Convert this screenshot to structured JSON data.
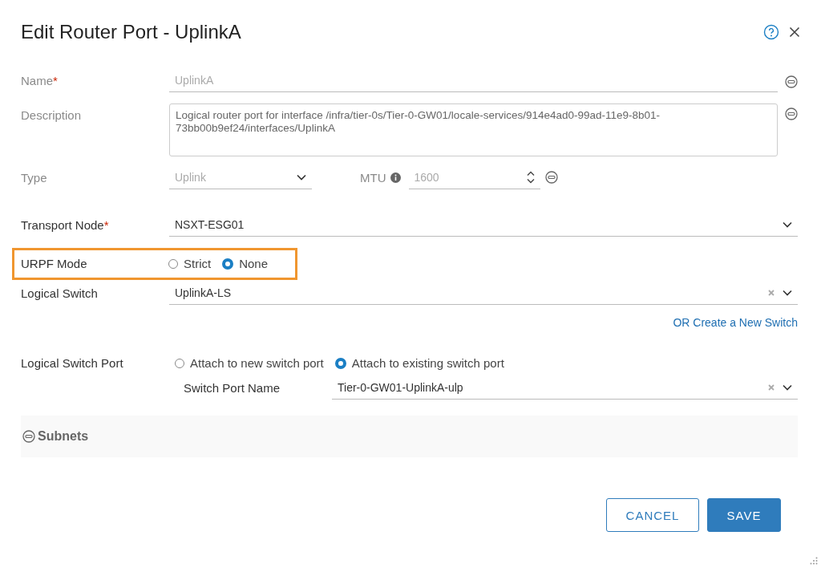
{
  "dialog": {
    "title": "Edit Router Port - UplinkA"
  },
  "name": {
    "label": "Name",
    "required_mark": "*",
    "value": "UplinkA",
    "disabled": true
  },
  "description": {
    "label": "Description",
    "value": "Logical router port for interface /infra/tier-0s/Tier-0-GW01/locale-services/914e4ad0-99ad-11e9-8b01-73bb00b9ef24/interfaces/UplinkA",
    "disabled": true
  },
  "type": {
    "label": "Type",
    "value": "Uplink",
    "disabled": true
  },
  "mtu": {
    "label": "MTU",
    "value": "1600",
    "disabled": true
  },
  "transport_node": {
    "label": "Transport Node",
    "required_mark": "*",
    "value": "NSXT-ESG01",
    "disabled": false
  },
  "urpf_mode": {
    "label": "URPF Mode",
    "highlighted": true,
    "options": [
      {
        "label": "Strict",
        "selected": false
      },
      {
        "label": "None",
        "selected": true
      }
    ]
  },
  "logical_switch": {
    "label": "Logical Switch",
    "value": "UplinkA-LS",
    "link": "OR Create a New Switch"
  },
  "logical_switch_port": {
    "label": "Logical Switch Port",
    "options": [
      {
        "label": "Attach to new switch port",
        "selected": false
      },
      {
        "label": "Attach to existing switch port",
        "selected": true
      }
    ],
    "switch_port_name": {
      "label": "Switch Port Name",
      "value": "Tier-0-GW01-UplinkA-ulp"
    }
  },
  "subnets": {
    "label": "Subnets"
  },
  "buttons": [
    {
      "label": "CANCEL",
      "kind": "secondary"
    },
    {
      "label": "SAVE",
      "kind": "primary"
    }
  ]
}
